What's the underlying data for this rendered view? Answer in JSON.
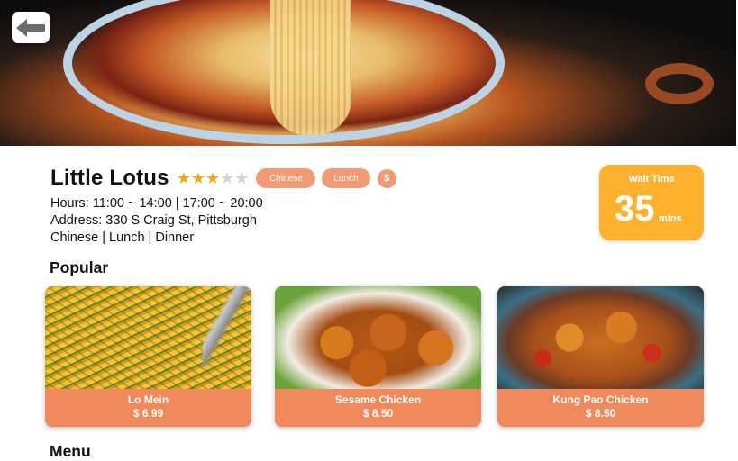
{
  "restaurant": {
    "name": "Little Lotus",
    "rating": 3,
    "rating_max": 5,
    "tags": [
      "Chinese",
      "Lunch"
    ],
    "price_symbol": "$",
    "hours": "Hours: 11:00 ~ 14:00 | 17:00 ~ 20:00",
    "address": "Address: 330 S Craig St, Pittsburgh",
    "categories": "Chinese | Lunch | Dinner"
  },
  "wait": {
    "label": "Wait Time",
    "value": "35",
    "unit": "mins"
  },
  "sections": {
    "popular": "Popular",
    "menu": "Menu"
  },
  "popular": [
    {
      "name": "Lo Mein",
      "price": "$ 6.99"
    },
    {
      "name": "Sesame Chicken",
      "price": "$ 8.50"
    },
    {
      "name": "Kung Pao Chicken",
      "price": "$ 8.50"
    }
  ],
  "icons": {
    "back": "arrow-left-icon",
    "star": "star-icon"
  },
  "colors": {
    "accent": "#f08a5d",
    "tag": "#f29a73",
    "wait": "#fdb12d",
    "star": "#f2a81d"
  }
}
